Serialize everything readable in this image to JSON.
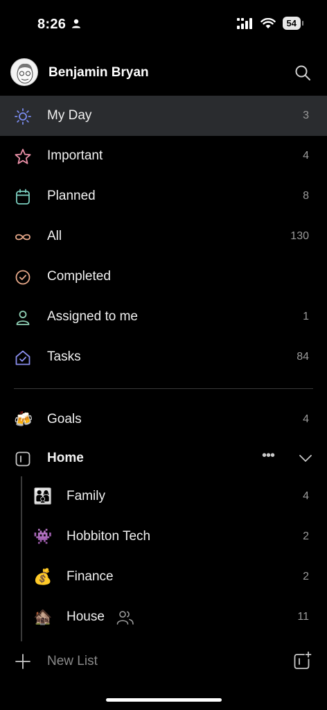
{
  "status_bar": {
    "time": "8:26",
    "battery": "54"
  },
  "profile": {
    "name": "Benjamin Bryan"
  },
  "smart_lists": [
    {
      "label": "My Day",
      "count": "3",
      "icon": "sun-icon"
    },
    {
      "label": "Important",
      "count": "4",
      "icon": "star-icon"
    },
    {
      "label": "Planned",
      "count": "8",
      "icon": "calendar-icon"
    },
    {
      "label": "All",
      "count": "130",
      "icon": "infinity-icon"
    },
    {
      "label": "Completed",
      "count": "",
      "icon": "check-circle-icon"
    },
    {
      "label": "Assigned to me",
      "count": "1",
      "icon": "person-icon"
    },
    {
      "label": "Tasks",
      "count": "84",
      "icon": "house-check-icon"
    }
  ],
  "lists": {
    "goals": {
      "label": "Goals",
      "count": "4",
      "emoji": "🍻"
    },
    "group": {
      "label": "Home",
      "more": "•••",
      "items": [
        {
          "label": "Family",
          "count": "4",
          "emoji": "👨‍👩‍👦"
        },
        {
          "label": "Hobbiton Tech",
          "count": "2",
          "emoji": "👾"
        },
        {
          "label": "Finance",
          "count": "2",
          "emoji": "💰"
        },
        {
          "label": "House",
          "count": "11",
          "emoji": "🏚️"
        }
      ]
    }
  },
  "footer": {
    "new_list_label": "New List"
  },
  "colors": {
    "background": "#000000",
    "selected_row": "#2a2c2f",
    "my_day_icon": "#7b8cf0",
    "important_icon": "#e98fa6",
    "planned_icon": "#7ccfc0",
    "all_icon": "#e8a98a",
    "completed_icon": "#e8a98a",
    "assigned_icon": "#8fd0b5",
    "tasks_icon": "#8b8ff0"
  }
}
